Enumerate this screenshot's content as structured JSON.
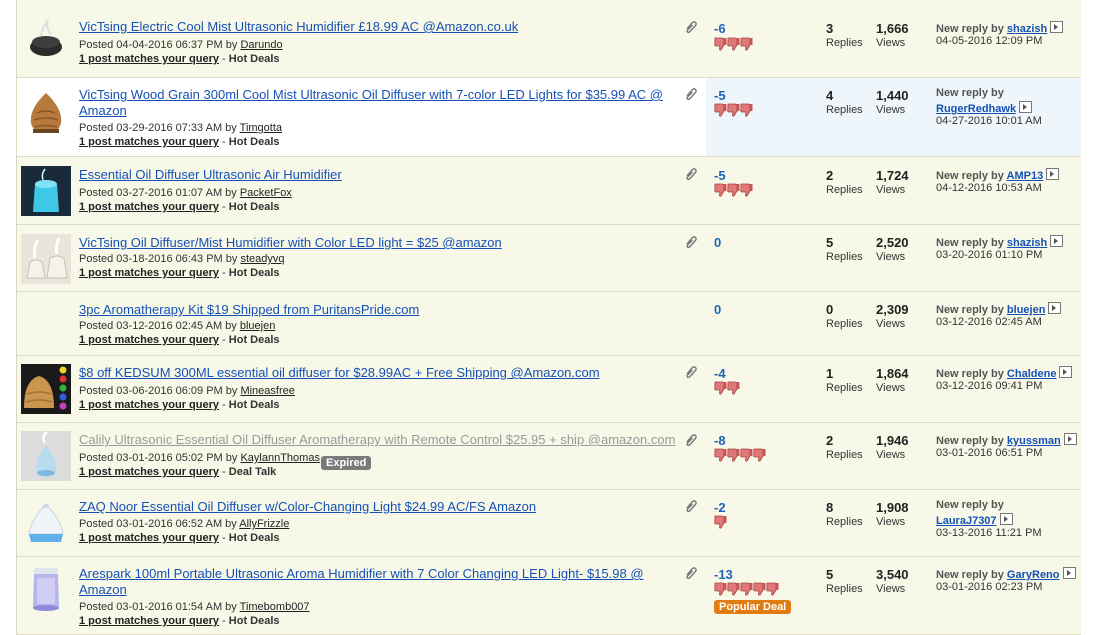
{
  "threads": [
    {
      "title": "VicTsing Electric Cool Mist Ultrasonic Humidifier £18.99 AC @Amazon.co.uk",
      "posted_prefix": "Posted 04-04-2016 06:37 PM by ",
      "author": "Darundo",
      "match_text": "1 post matches your query",
      "forum": "Hot Deals",
      "score": "-6",
      "thumbs_down": 3,
      "replies": "3",
      "views": "1,666",
      "last_label": "New reply by ",
      "last_user": "shazish",
      "last_date": "04-05-2016 12:09 PM",
      "thumb_icon": "humidifier-dark-icon"
    },
    {
      "title": "VicTsing Wood Grain 300ml Cool Mist Ultrasonic Oil Diffuser with 7-color LED Lights for $35.99 AC @ Amazon",
      "posted_prefix": "Posted 03-29-2016 07:33 AM by ",
      "author": "Timgotta",
      "match_text": "1 post matches your query",
      "forum": "Hot Deals",
      "score": "-5",
      "thumbs_down": 3,
      "replies": "4",
      "views": "1,440",
      "last_label": "New reply by",
      "last_user": "RugerRedhawk",
      "last_date": "04-27-2016 10:01 AM",
      "thumb_icon": "wood-diffuser-icon"
    },
    {
      "title": "Essential Oil Diffuser Ultrasonic Air Humidifier",
      "posted_prefix": "Posted 03-27-2016 01:07 AM by ",
      "author": "PacketFox",
      "match_text": "1 post matches your query",
      "forum": "Hot Deals",
      "score": "-5",
      "thumbs_down": 3,
      "replies": "2",
      "views": "1,724",
      "last_label": "New reply by ",
      "last_user": "AMP13",
      "last_date": "04-12-2016 10:53 AM",
      "thumb_icon": "blue-diffuser-icon"
    },
    {
      "title": "VicTsing Oil Diffuser/Mist Humidifier with Color LED light = $25 @amazon",
      "posted_prefix": "Posted 03-18-2016 06:43 PM by ",
      "author": "steadyvq",
      "match_text": "1 post matches your query",
      "forum": "Hot Deals",
      "score": "0",
      "thumbs_down": 0,
      "replies": "5",
      "views": "2,520",
      "last_label": "New reply by ",
      "last_user": "shazish",
      "last_date": "03-20-2016 01:10 PM",
      "thumb_icon": "mist-diffuser-icon"
    },
    {
      "title": "3pc Aromatherapy Kit $19 Shipped from PuritansPride.com",
      "posted_prefix": "Posted 03-12-2016 02:45 AM by ",
      "author": "bluejen",
      "match_text": "1 post matches your query",
      "forum": "Hot Deals",
      "score": "0",
      "thumbs_down": 0,
      "replies": "0",
      "views": "2,309",
      "last_label": "New reply by ",
      "last_user": "bluejen",
      "last_date": "03-12-2016 02:45 AM",
      "thumb_icon": ""
    },
    {
      "title": "$8 off KEDSUM 300ML essential oil diffuser for $28.99AC + Free Shipping @Amazon.com",
      "posted_prefix": "Posted 03-06-2016 06:09 PM by ",
      "author": "Mineasfree",
      "match_text": "1 post matches your query",
      "forum": "Hot Deals",
      "score": "-4",
      "thumbs_down": 2,
      "replies": "1",
      "views": "1,864",
      "last_label": "New reply by ",
      "last_user": "Chaldene",
      "last_date": "03-12-2016 09:41 PM",
      "thumb_icon": "kedsum-diffuser-icon"
    },
    {
      "title": "Calily Ultrasonic Essential Oil Diffuser Aromatherapy with Remote Control $25.95 + ship @amazon.com",
      "posted_prefix": "Posted 03-01-2016 05:02 PM by ",
      "author": "KaylannThomas",
      "match_text": "1 post matches your query",
      "forum": "Deal Talk",
      "score": "-8",
      "thumbs_down": 4,
      "replies": "2",
      "views": "1,946",
      "last_label": "New reply by ",
      "last_user": "kyussman",
      "last_date": "03-01-2016 06:51 PM",
      "badge": "Expired",
      "thumb_icon": "calily-diffuser-icon"
    },
    {
      "title": "ZAQ Noor Essential Oil Diffuser w/Color-Changing Light $24.99 AC/FS Amazon",
      "posted_prefix": "Posted 03-01-2016 06:52 AM by ",
      "author": "AllyFrizzle",
      "match_text": "1 post matches your query",
      "forum": "Hot Deals",
      "score": "-2",
      "thumbs_down": 1,
      "replies": "8",
      "views": "1,908",
      "last_label": "New reply by",
      "last_user": "LauraJ7307",
      "last_date": "03-13-2016 11:21 PM",
      "thumb_icon": "zaq-diffuser-icon"
    },
    {
      "title": "Arespark 100ml Portable Ultrasonic Aroma Humidifier with 7 Color Changing LED Light- $15.98 @ Amazon",
      "posted_prefix": "Posted 03-01-2016 01:54 AM by ",
      "author": "Timebomb007",
      "match_text": "1 post matches your query",
      "forum": "Hot Deals",
      "score": "-13",
      "thumbs_down": 5,
      "replies": "5",
      "views": "3,540",
      "last_label": "New reply by ",
      "last_user": "GaryReno",
      "last_date": "03-01-2016 02:23 PM",
      "badge": "Popular Deal",
      "thumb_icon": "arespark-diffuser-icon"
    }
  ],
  "labels": {
    "replies": "Replies",
    "views": "Views",
    "separator": " - "
  },
  "colors": {
    "link": "#1551b4",
    "score": "#1f63b6",
    "row_bg": "#f8f8e9",
    "thumb_down": "#e07878",
    "expired": "#7a7a7a",
    "popular": "#e07c12"
  }
}
